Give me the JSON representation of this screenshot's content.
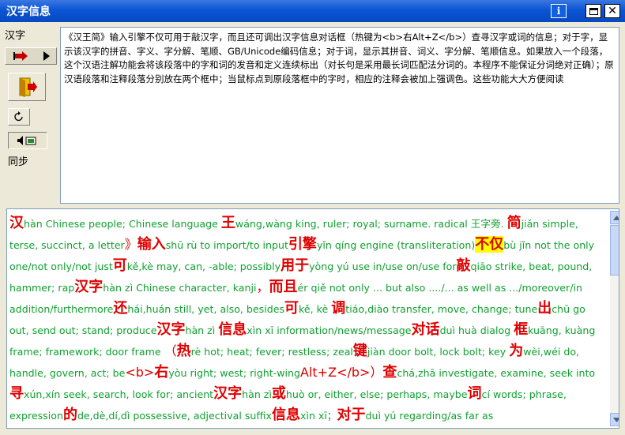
{
  "window": {
    "title": "汉字信息",
    "info_icon": "info-icon",
    "maximize_icon": "maximize-icon",
    "close_icon": "close-icon",
    "close_glyph": "✕"
  },
  "left": {
    "label_hanzi": "汉字",
    "label_sync": "同步",
    "icons": {
      "nav": "navigate-icon",
      "door": "open-door-icon",
      "refresh": "refresh-icon",
      "sound": "sound-icon"
    }
  },
  "input": {
    "text": "《汉王简》输入引擎不仅可用于敲汉字，而且还可调出汉字信息对话框（热键为<b>右Alt+Z</b>）查寻汉字或词的信息；对于字，显示该汉字的拼音、字义、字分解、笔顺、GB/Unicode编码信息；对于词，显示其拼音、词义、字分解、笔顺信息。如果放入一个段落，这个汉语注解功能会将该段落中的字和词的发音和定义连续标出（对长句是采用最长词匹配法分词的。本程序不能保证分词绝对正确）；原汉语段落和注释段落分别放在两个框中；当鼠标点到原段落框中的字时，相应的注释会被加上强调色。这些功能大大方便阅读"
  },
  "gloss": {
    "colors": {
      "hanzi": "#e00000",
      "gloss": "#10a030",
      "highlight": "#ffff00"
    },
    "entries": [
      {
        "hz": "汉",
        "py": "hàn",
        "def": " Chinese people; Chinese language "
      },
      {
        "hz": "王",
        "py": "wáng,wàng",
        "def": " king, ruler; royal; surname. radical 王字旁. "
      },
      {
        "hz": "简",
        "py": "jiǎn",
        "def": " simple, terse, succinct, a letter"
      },
      {
        "pt": "》"
      },
      {
        "hz": "输入",
        "py": "shū rù",
        "def": " to import/to input"
      },
      {
        "hz": "引擎",
        "py": "yǐn qíng",
        "def": " engine (transliteration)"
      },
      {
        "hz": "不仅",
        "hl": true,
        "py": "bù jǐn",
        "def": " not the only one/not only/not just"
      },
      {
        "hz": "可",
        "py": "kě,kè",
        "def": " may, can, -able; possibly"
      },
      {
        "hz": "用于",
        "py": "yòng yú",
        "def": " use in/use on/use for"
      },
      {
        "hz": "敲",
        "py": "qiāo",
        "def": " strike, beat, pound, hammer; rap"
      },
      {
        "hz": "汉字",
        "py": "hàn zì",
        "def": " Chinese character, kanji"
      },
      {
        "pt": "，"
      },
      {
        "hz": "而且",
        "py": "ér qiě",
        "def": " not only ... but also ..../... as well as .../moreover/in addition/furthermore"
      },
      {
        "hz": "还",
        "py": "hái,huán",
        "def": " still, yet, also, besides"
      },
      {
        "hz": "可",
        "py": "kě, kè",
        "def": " "
      },
      {
        "hz": "调",
        "py": "tiáo,diào",
        "def": " transfer, move, change; tune"
      },
      {
        "hz": "出",
        "py": "chū",
        "def": " go out, send out; stand; produce"
      },
      {
        "hz": "汉字",
        "py": "hàn zì",
        "def": " "
      },
      {
        "hz": "信息",
        "py": "xìn xī",
        "def": " information/news/message"
      },
      {
        "hz": "对话",
        "py": "duì huà",
        "def": " dialog "
      },
      {
        "hz": "框",
        "py": "kuāng, kuàng",
        "def": " frame; framework; door frame "
      },
      {
        "pt": "（"
      },
      {
        "hz": "热",
        "py": "rè",
        "def": " hot; heat; fever; restless; zeal"
      },
      {
        "hz": "键",
        "py": "jiàn",
        "def": " door bolt, lock bolt; key "
      },
      {
        "hz": "为",
        "py": "wèi,wéi",
        "def": " do, handle, govern, act; be"
      },
      {
        "pt": "<b>"
      },
      {
        "hz": "右",
        "py": "yòu",
        "def": " right; west; right-wing"
      },
      {
        "pt": "Alt+Z</b>）"
      },
      {
        "hz": "查",
        "py": "chá,zhā",
        "def": " investigate, examine, seek into"
      },
      {
        "hz": "寻",
        "py": "xún,xín",
        "def": " seek, search, look for; ancient"
      },
      {
        "hz": "汉字",
        "py": "hàn zì",
        "def": ""
      },
      {
        "hz": "或",
        "py": "huò",
        "def": " or, either, else; perhaps, maybe"
      },
      {
        "hz": "词",
        "py": "cí",
        "def": " words; phrase, expression"
      },
      {
        "hz": "的",
        "py": "de,dè,dí,dì",
        "def": " possessive, adjectival suffix"
      },
      {
        "hz": "信息",
        "py": "xìn xī",
        "def": "；"
      },
      {
        "hz": "对于",
        "py": "duì yú",
        "def": " regarding/as far as "
      }
    ]
  },
  "scrollbar": {
    "up_icon": "scroll-up-icon",
    "down_icon": "scroll-down-icon"
  }
}
